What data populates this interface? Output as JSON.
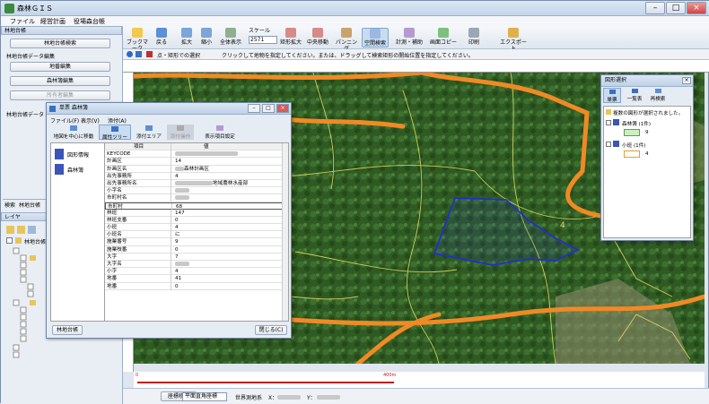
{
  "app": {
    "title": "森林ＧＩＳ"
  },
  "menu": [
    "ファイル",
    "経営計画",
    "役場森台帳"
  ],
  "toolbar": [
    {
      "label": "ブックマーク",
      "icon": "star-icon"
    },
    {
      "label": "戻る",
      "icon": "back-icon"
    },
    {
      "label": "拡大",
      "icon": "zoom-in-icon"
    },
    {
      "label": "縮小",
      "icon": "zoom-out-icon"
    },
    {
      "label": "全体表示",
      "icon": "full-extent-icon"
    },
    {
      "label": "矩形拡大",
      "icon": "rect-zoom-icon"
    },
    {
      "label": "中央移動",
      "icon": "center-move-icon"
    },
    {
      "label": "パンニング",
      "icon": "pan-hand-icon"
    },
    {
      "label": "空間検索",
      "icon": "spatial-search-icon"
    },
    {
      "label": "計測・補助",
      "icon": "measure-icon"
    },
    {
      "label": "画面コピー",
      "icon": "copy-icon"
    },
    {
      "label": "印刷",
      "icon": "print-icon"
    },
    {
      "label": "エクスポート",
      "icon": "export-icon"
    }
  ],
  "scale": {
    "label": "スケール",
    "value": "2571"
  },
  "infobar": {
    "mode": "点・矩形での選択",
    "hint": "クリックして地物を指定してください。または、ドラッグして検索矩形の開始位置を指定してください。"
  },
  "left_panel": {
    "header": "林地台帳",
    "search_button": "林地台帳検索",
    "section1": "林地台帳データ編集",
    "buttons1": [
      "地番編集",
      "森林簿編集",
      "所有者編集"
    ],
    "section2": "林地台帳データ",
    "tabs": [
      "検索",
      "林地台帳"
    ],
    "layer_header": "レイヤ",
    "layer_root": "林地台帳"
  },
  "dialog": {
    "title": "単票 森林簿",
    "menu": [
      "ファイル(F)",
      "表示(V)",
      "添付(A)"
    ],
    "tools": [
      "地図を中心に移動",
      "属性ツリー",
      "添付エリア",
      "添付操作",
      "表示項目設定"
    ],
    "tree": [
      "図形情報",
      "森林簿"
    ],
    "columns": [
      "項目",
      "値"
    ],
    "rows": [
      {
        "key": "KEYCODE",
        "value": ""
      },
      {
        "key": "計画区",
        "value": "14"
      },
      {
        "key": "計画区名",
        "value": "森林計画区"
      },
      {
        "key": "出先事務所",
        "value": "4"
      },
      {
        "key": "出先事務所名",
        "value": "地域農林水産部"
      },
      {
        "key": "小字名",
        "value": ""
      },
      {
        "key": "市町村名",
        "value": ""
      },
      {
        "key": "市町村",
        "value": "68"
      },
      {
        "key": "林班",
        "value": "147"
      },
      {
        "key": "林班支番",
        "value": "0"
      },
      {
        "key": "小班",
        "value": "4"
      },
      {
        "key": "小班名",
        "value": "に"
      },
      {
        "key": "施業番号",
        "value": "9"
      },
      {
        "key": "施業枝番",
        "value": "0"
      },
      {
        "key": "大字",
        "value": "7"
      },
      {
        "key": "大字名",
        "value": ""
      },
      {
        "key": "小字",
        "value": "4"
      },
      {
        "key": "地番",
        "value": "41"
      },
      {
        "key": "地番",
        "value": "0"
      }
    ],
    "footer_left": "林地台帳",
    "footer_right": "閉じる(C)"
  },
  "shape_panel": {
    "title": "図形選択",
    "buttons": [
      "単票",
      "一覧表",
      "再検索"
    ],
    "message": "複数の図形が選択されました。",
    "groups": [
      {
        "name": "森林簿 (1件)",
        "item": "9"
      },
      {
        "name": "小班 (1件)",
        "item": "4"
      }
    ]
  },
  "map": {
    "label": "4"
  },
  "ruler": {
    "left": "0",
    "right": "400m"
  },
  "status": {
    "move_button": "座標移動",
    "coord_system": "平面直角座標",
    "geo_label": "世界測地系",
    "x_label": "X：",
    "y_label": "Y："
  },
  "colors": {
    "road": "#f08a24",
    "selection": "#2030c8",
    "parcel": "#e8e060",
    "forest": "#2f5a22"
  }
}
